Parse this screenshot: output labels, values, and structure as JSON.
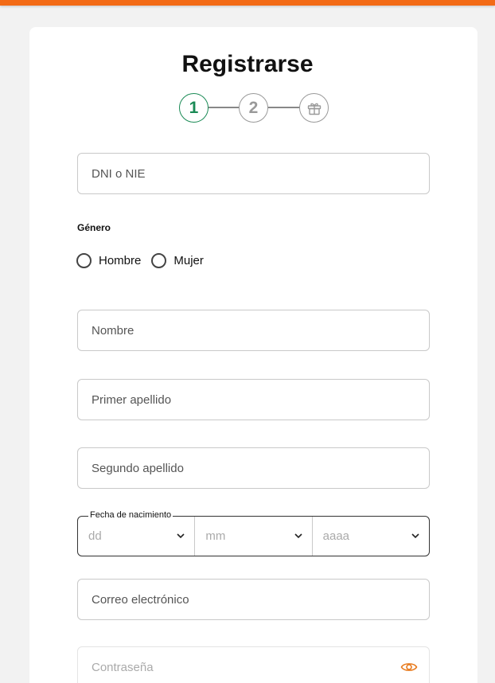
{
  "title": "Registrarse",
  "stepper": {
    "steps": [
      {
        "label": "1",
        "state": "active"
      },
      {
        "label": "2",
        "state": "inactive"
      },
      {
        "icon": "gift-icon",
        "state": "inactive"
      }
    ],
    "active_color": "#1a8a55"
  },
  "fields": {
    "dni": {
      "placeholder": "DNI o NIE",
      "value": ""
    },
    "nombre": {
      "placeholder": "Nombre",
      "value": ""
    },
    "primer_apellido": {
      "placeholder": "Primer apellido",
      "value": ""
    },
    "segundo_apellido": {
      "placeholder": "Segundo apellido",
      "value": ""
    },
    "correo": {
      "placeholder": "Correo electrónico",
      "value": ""
    },
    "password": {
      "placeholder": "Contraseña",
      "value": "",
      "toggle_icon": "eye-icon"
    }
  },
  "genero": {
    "label": "Género",
    "options": [
      "Hombre",
      "Mujer"
    ]
  },
  "fecha_nacimiento": {
    "label": "Fecha de nacimiento",
    "day_placeholder": "dd",
    "month_placeholder": "mm",
    "year_placeholder": "aaaa"
  },
  "colors": {
    "top_bar": "#f36b16",
    "eye_icon": "#e87b1e"
  }
}
